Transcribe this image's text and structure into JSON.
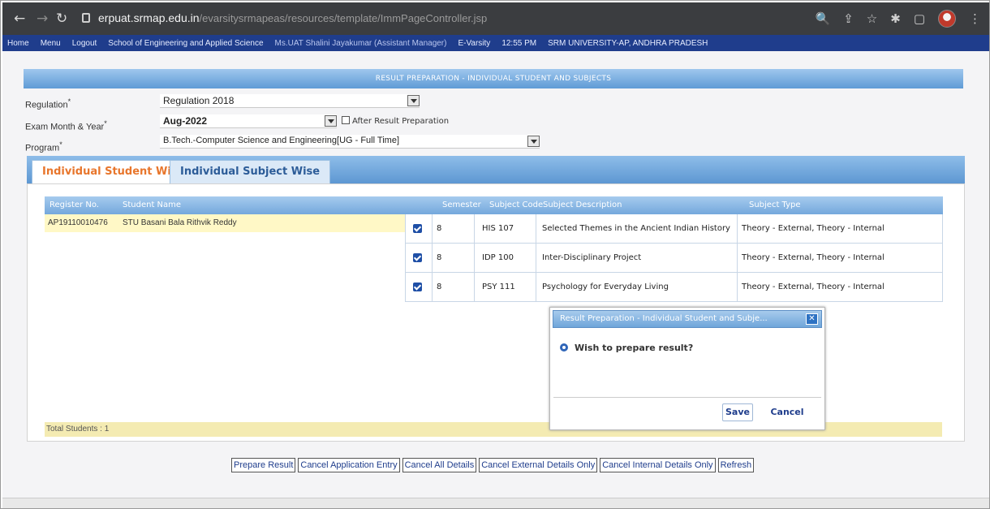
{
  "browser": {
    "url_host": "erpuat.srmap.edu.in",
    "url_path": "/evarsitysrmapeas/resources/template/ImmPageController.jsp"
  },
  "appbar": {
    "items": [
      "Home",
      "Menu",
      "Logout",
      "School of Engineering and Applied Science",
      "Ms.UAT Shalini Jayakumar (Assistant Manager)",
      "E-Varsity",
      "12:55 PM",
      "SRM UNIVERSITY-AP, ANDHRA PRADESH"
    ]
  },
  "page": {
    "title": "RESULT PREPARATION - INDIVIDUAL STUDENT AND SUBJECTS"
  },
  "form": {
    "regulation_label": "Regulation",
    "regulation_value": "Regulation 2018",
    "exam_label": "Exam Month & Year",
    "exam_value": "Aug-2022",
    "after_result_label": "After Result Preparation",
    "program_label": "Program",
    "program_value": "B.Tech.-Computer Science and Engineering[UG - Full Time]"
  },
  "tabs": {
    "student_wise": "Individual Student Wise",
    "subject_wise": "Individual Subject Wise"
  },
  "student_grid": {
    "headers": [
      "Register No.",
      "Student Name"
    ],
    "rows": [
      {
        "reg": "AP19110010476",
        "name": "STU Basani Bala Rithvik Reddy"
      }
    ],
    "total_label": "Total Students : 1"
  },
  "subject_grid": {
    "headers": [
      "Semester",
      "Subject Code",
      "Subject Description",
      "Subject Type"
    ],
    "rows": [
      {
        "sem": "8",
        "code": "HIS 107",
        "desc": "Selected Themes in the Ancient Indian History",
        "type": "Theory - External, Theory - Internal"
      },
      {
        "sem": "8",
        "code": "IDP 100",
        "desc": "Inter-Disciplinary Project",
        "type": "Theory - External, Theory - Internal"
      },
      {
        "sem": "8",
        "code": "PSY 111",
        "desc": "Psychology for Everyday Living",
        "type": "Theory - External, Theory - Internal"
      }
    ]
  },
  "dialog": {
    "title": "Result Preparation - Individual Student and Subje...",
    "message": "Wish to prepare result?",
    "save": "Save",
    "cancel": "Cancel"
  },
  "buttons": {
    "prepare": "Prepare Result",
    "cancel_app": "Cancel Application Entry",
    "cancel_all": "Cancel All Details",
    "cancel_ext": "Cancel External Details Only",
    "cancel_int": "Cancel Internal Details Only",
    "refresh": "Refresh"
  }
}
